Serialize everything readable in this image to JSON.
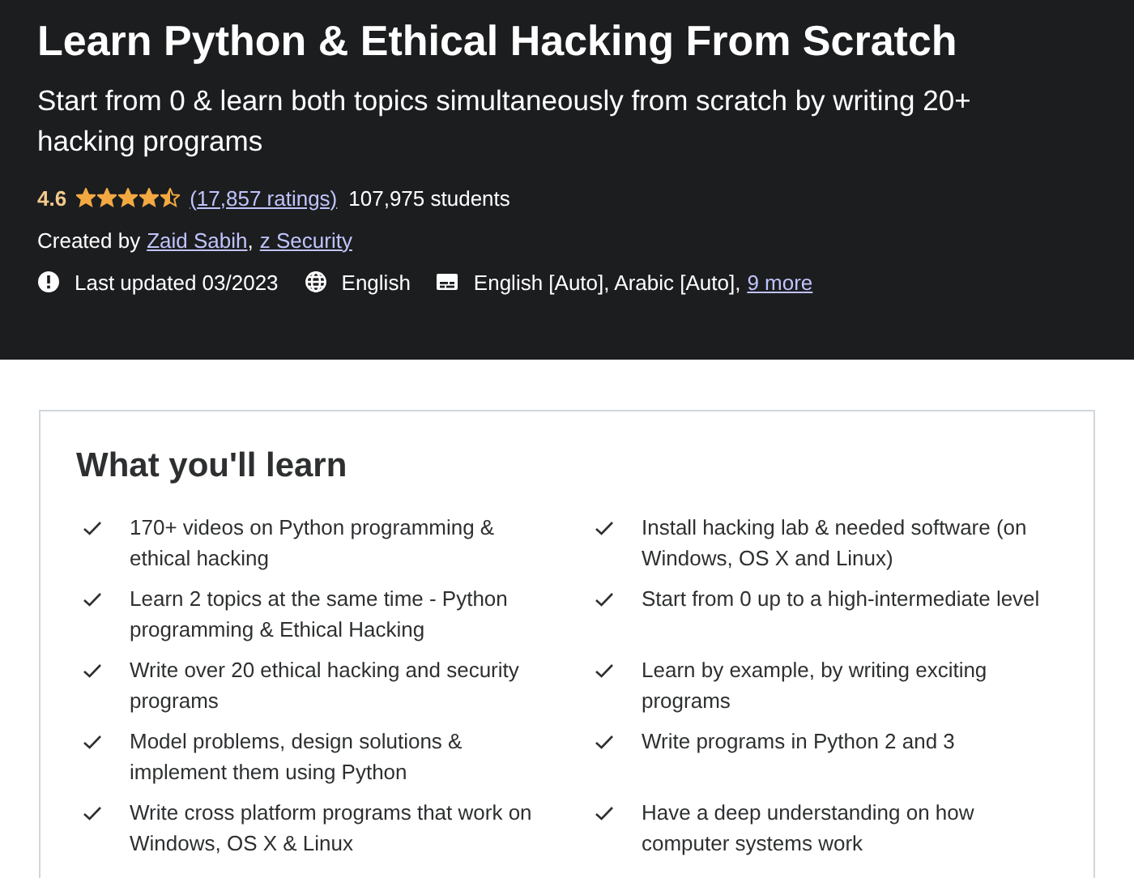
{
  "header": {
    "title": "Learn Python & Ethical Hacking From Scratch",
    "subtitle": "Start from 0 & learn both topics simultaneously from scratch by writing 20+ hacking programs",
    "rating": "4.6",
    "stars": 4.5,
    "ratings_link": "(17,857 ratings)",
    "students": "107,975 students",
    "created_by": "Created by",
    "authors": [
      "Zaid Sabih",
      "z Security"
    ],
    "author_separator": ",",
    "last_updated": "Last updated 03/2023",
    "language": "English",
    "captions": "English [Auto], Arabic [Auto],",
    "captions_more": "9 more"
  },
  "learn": {
    "title": "What you'll learn",
    "items": [
      {
        "text": "170+ videos on Python programming & ethical hacking"
      },
      {
        "text": "Install hacking lab & needed software (on Windows, OS X and Linux)"
      },
      {
        "text": "Learn 2 topics at the same time - Python programming & Ethical Hacking"
      },
      {
        "text": "Start from 0 up to a high-intermediate level"
      },
      {
        "text": "Write over 20 ethical hacking and security programs"
      },
      {
        "text": "Learn by example, by writing exciting programs"
      },
      {
        "text": "Model problems, design solutions & implement them using Python"
      },
      {
        "text": "Write programs in Python 2 and 3"
      },
      {
        "text": "Write cross platform programs that work on Windows, OS X & Linux"
      },
      {
        "text": "Have a deep understanding on how computer systems work"
      }
    ]
  }
}
